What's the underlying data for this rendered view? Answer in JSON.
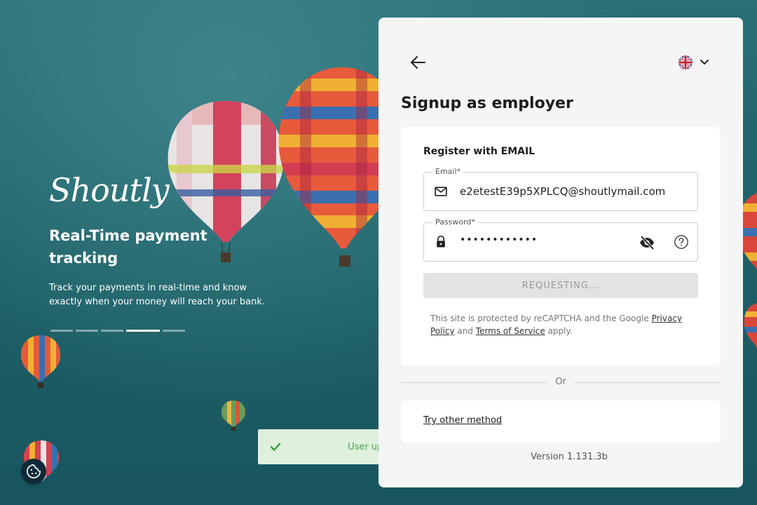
{
  "hero": {
    "brand": "Shoutly",
    "brand_tm": "™",
    "title": "Real-Time payment tracking",
    "description": "Track your payments in real-time and know exactly when your money will reach your bank.",
    "carousel_active_index": 3,
    "carousel_count": 5
  },
  "toast": {
    "message": "User updated",
    "icon": "checkmark-icon",
    "color": "#4aa04a"
  },
  "panel": {
    "title": "Signup as employer",
    "language_flag": "uk-flag-icon",
    "form": {
      "section_label": "Register with EMAIL",
      "email": {
        "label": "Email*",
        "value": "e2etestE39p5XPLCQ@shoutlymail.com"
      },
      "password": {
        "label": "Password*",
        "value": "••••••••••••"
      },
      "submit_label": "REQUESTING...",
      "legal": {
        "prefix": "This site is protected by reCAPTCHA and the Google ",
        "privacy_link": "Privacy Policy",
        "middle": " and ",
        "terms_link": "Terms of Service",
        "suffix": " apply."
      }
    },
    "divider_label": "Or",
    "other_method_label": "Try other method",
    "version": "Version 1.131.3b"
  },
  "colors": {
    "background": "#1f5f6a",
    "panel": "#f5f5f5",
    "toast_bg": "#dff0dd"
  }
}
